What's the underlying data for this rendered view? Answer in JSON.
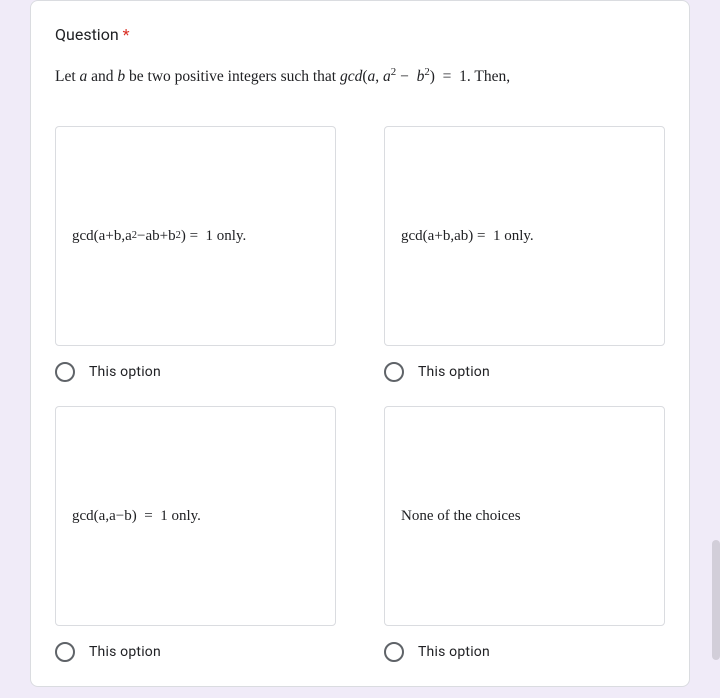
{
  "question": {
    "title_label": "Question",
    "required_mark": "*",
    "prompt_html": "Let <span class='it'>a</span> and <span class='it'>b</span> be two positive integers such that <span class='it'>gcd</span>(<span class='it'>a</span>, <span class='it'>a</span><sup>2</sup> − &nbsp;<span class='it'>b</span><sup>2</sup>)&nbsp; = &nbsp;1. Then,"
  },
  "options": [
    {
      "content_html": "<span class='it'>gcd</span>(<span class='it'>a</span> + <span class='it'>b</span>, <span class='it'>a</span><sup>2</sup> − <span class='it'>ab</span> + <span class='it'>b</span><sup>2</sup>) = &nbsp;1 only.",
      "label": "This option"
    },
    {
      "content_html": "<span class='it'>gcd</span>(<span class='it'>a</span> + <span class='it'>b</span>, <span class='it'>ab</span>) = &nbsp;1 only.",
      "label": "This option"
    },
    {
      "content_html": "<span class='it'>gcd</span>(<span class='it'>a</span>, <span class='it'>a</span> − <span class='it'>b</span>) &nbsp;= &nbsp;1 only.",
      "label": "This option"
    },
    {
      "content_html": "None of the choices",
      "label": "This option"
    }
  ]
}
